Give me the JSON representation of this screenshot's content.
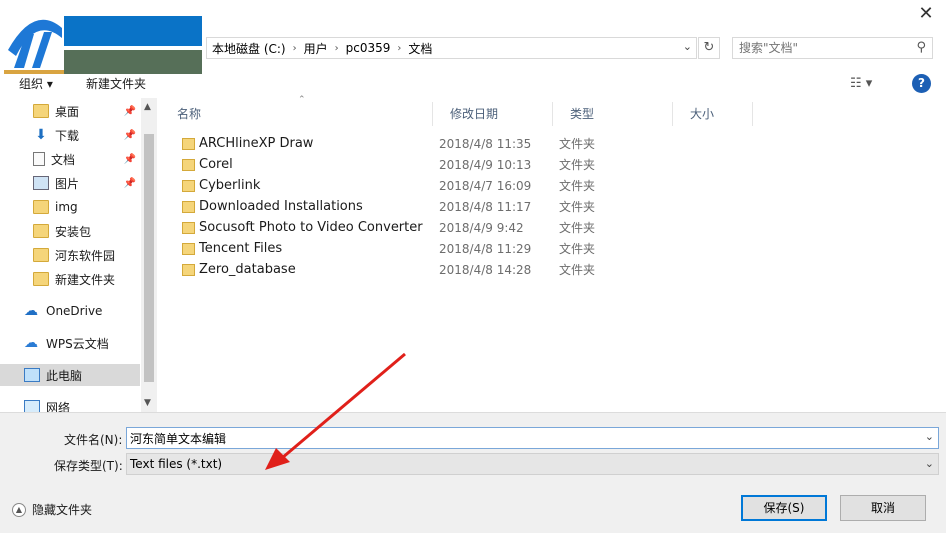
{
  "window": {
    "close_glyph": "✕"
  },
  "address": {
    "crumbs": [
      "本地磁盘 (C:)",
      "用户",
      "pc0359",
      "文档"
    ],
    "separator": "›"
  },
  "search": {
    "placeholder": "搜索\"文档\""
  },
  "toolbar": {
    "organize_label": "组织 ▾",
    "new_folder_label": "新建文件夹",
    "help_label": "?"
  },
  "nav": {
    "items": [
      {
        "label": "桌面",
        "icon": "folder-icon",
        "pinned": true
      },
      {
        "label": "下载",
        "icon": "download-icon",
        "pinned": true
      },
      {
        "label": "文档",
        "icon": "document-icon",
        "pinned": true
      },
      {
        "label": "图片",
        "icon": "picture-icon",
        "pinned": true
      },
      {
        "label": "img",
        "icon": "folder-icon",
        "pinned": false
      },
      {
        "label": "安装包",
        "icon": "folder-icon",
        "pinned": false
      },
      {
        "label": "河东软件园",
        "icon": "folder-icon",
        "pinned": false
      },
      {
        "label": "新建文件夹",
        "icon": "folder-icon",
        "pinned": false
      },
      {
        "label": "OneDrive",
        "icon": "cloud-icon",
        "pinned": false
      },
      {
        "label": "WPS云文档",
        "icon": "cloud-icon",
        "pinned": false
      },
      {
        "label": "此电脑",
        "icon": "computer-icon",
        "pinned": false
      },
      {
        "label": "网络",
        "icon": "network-icon",
        "pinned": false
      }
    ]
  },
  "columns": {
    "name": "名称",
    "modified": "修改日期",
    "type": "类型",
    "size": "大小"
  },
  "files": [
    {
      "name": "ARCHlineXP Draw",
      "modified": "2018/4/8 11:35",
      "type": "文件夹"
    },
    {
      "name": "Corel",
      "modified": "2018/4/9 10:13",
      "type": "文件夹"
    },
    {
      "name": "Cyberlink",
      "modified": "2018/4/7 16:09",
      "type": "文件夹"
    },
    {
      "name": "Downloaded Installations",
      "modified": "2018/4/8 11:17",
      "type": "文件夹"
    },
    {
      "name": "Socusoft Photo to Video Converter",
      "modified": "2018/4/9 9:42",
      "type": "文件夹"
    },
    {
      "name": "Tencent Files",
      "modified": "2018/4/8 11:29",
      "type": "文件夹"
    },
    {
      "name": "Zero_database",
      "modified": "2018/4/8 14:28",
      "type": "文件夹"
    }
  ],
  "save": {
    "filename_label": "文件名(N):",
    "filename_value": "河东简单文本编辑",
    "filetype_label": "保存类型(T):",
    "filetype_value": "Text files (*.txt)",
    "hide_folders_label": "隐藏文件夹",
    "save_button": "保存(S)",
    "cancel_button": "取消"
  },
  "colors": {
    "accent": "#0078d7",
    "annotation_arrow": "#e0201a",
    "logo_blue": "#0a73c7",
    "logo_green": "#566f58"
  }
}
